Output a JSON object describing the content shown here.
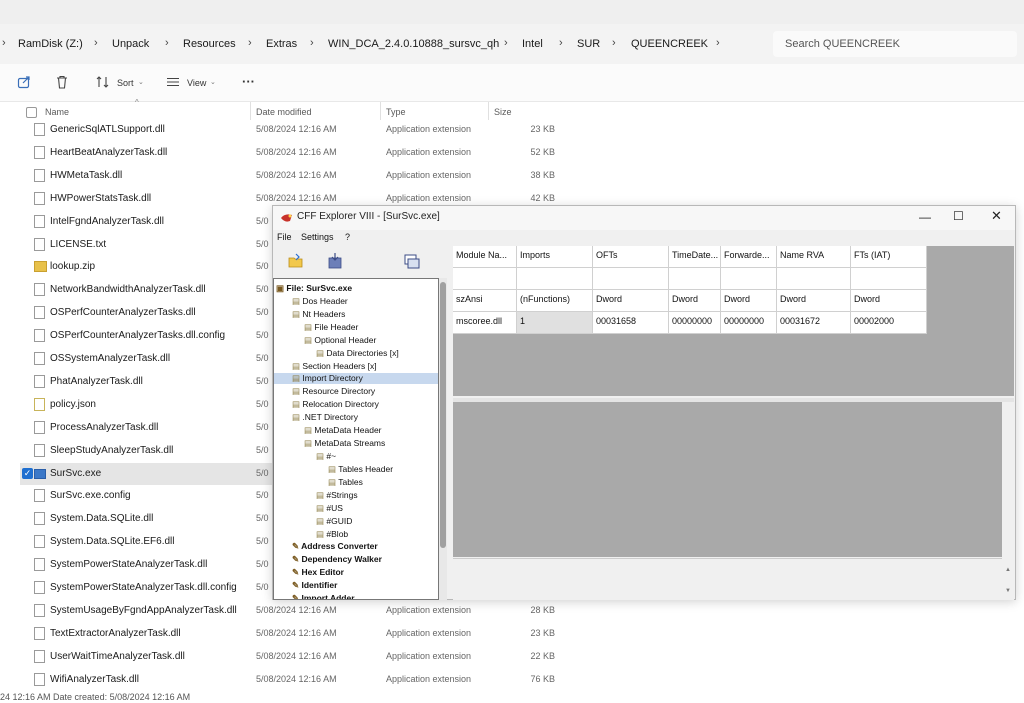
{
  "address": {
    "crumbs": [
      "RamDisk (Z:)",
      "Unpack",
      "Resources",
      "Extras",
      "WIN_DCA_2.4.0.10888_sursvc_qh",
      "Intel",
      "SUR",
      "QUEENCREEK"
    ],
    "search_placeholder": "Search QUEENCREEK"
  },
  "toolbar": {
    "sort_label": "Sort",
    "view_label": "View",
    "more_label": "···"
  },
  "columns": {
    "name": "Name",
    "date": "Date modified",
    "type": "Type",
    "size": "Size"
  },
  "files": [
    {
      "name": "GenericSqlATLSupport.dll",
      "date": "5/08/2024 12:16 AM",
      "type": "Application extension",
      "size": "23 KB"
    },
    {
      "name": "HeartBeatAnalyzerTask.dll",
      "date": "5/08/2024 12:16 AM",
      "type": "Application extension",
      "size": "52 KB"
    },
    {
      "name": "HWMetaTask.dll",
      "date": "5/08/2024 12:16 AM",
      "type": "Application extension",
      "size": "38 KB"
    },
    {
      "name": "HWPowerStatsTask.dll",
      "date": "5/08/2024 12:16 AM",
      "type": "Application extension",
      "size": "42 KB"
    },
    {
      "name": "IntelFgndAnalyzerTask.dll",
      "date": "5/0",
      "type": "",
      "size": ""
    },
    {
      "name": "LICENSE.txt",
      "date": "5/0",
      "type": "",
      "size": ""
    },
    {
      "name": "lookup.zip",
      "date": "5/0",
      "type": "",
      "size": ""
    },
    {
      "name": "NetworkBandwidthAnalyzerTask.dll",
      "date": "5/0",
      "type": "",
      "size": ""
    },
    {
      "name": "OSPerfCounterAnalyzerTasks.dll",
      "date": "5/0",
      "type": "",
      "size": ""
    },
    {
      "name": "OSPerfCounterAnalyzerTasks.dll.config",
      "date": "5/0",
      "type": "",
      "size": ""
    },
    {
      "name": "OSSystemAnalyzerTask.dll",
      "date": "5/0",
      "type": "",
      "size": ""
    },
    {
      "name": "PhatAnalyzerTask.dll",
      "date": "5/0",
      "type": "",
      "size": ""
    },
    {
      "name": "policy.json",
      "date": "5/0",
      "type": "",
      "size": ""
    },
    {
      "name": "ProcessAnalyzerTask.dll",
      "date": "5/0",
      "type": "",
      "size": ""
    },
    {
      "name": "SleepStudyAnalyzerTask.dll",
      "date": "5/0",
      "type": "",
      "size": ""
    },
    {
      "name": "SurSvc.exe",
      "date": "5/0",
      "type": "",
      "size": ""
    },
    {
      "name": "SurSvc.exe.config",
      "date": "5/0",
      "type": "",
      "size": ""
    },
    {
      "name": "System.Data.SQLite.dll",
      "date": "5/0",
      "type": "",
      "size": ""
    },
    {
      "name": "System.Data.SQLite.EF6.dll",
      "date": "5/0",
      "type": "",
      "size": ""
    },
    {
      "name": "SystemPowerStateAnalyzerTask.dll",
      "date": "5/0",
      "type": "",
      "size": ""
    },
    {
      "name": "SystemPowerStateAnalyzerTask.dll.config",
      "date": "5/0",
      "type": "",
      "size": ""
    },
    {
      "name": "SystemUsageByFgndAppAnalyzerTask.dll",
      "date": "5/08/2024 12:16 AM",
      "type": "Application extension",
      "size": "28 KB"
    },
    {
      "name": "TextExtractorAnalyzerTask.dll",
      "date": "5/08/2024 12:16 AM",
      "type": "Application extension",
      "size": "23 KB"
    },
    {
      "name": "UserWaitTimeAnalyzerTask.dll",
      "date": "5/08/2024 12:16 AM",
      "type": "Application extension",
      "size": "22 KB"
    },
    {
      "name": "WifiAnalyzerTask.dll",
      "date": "5/08/2024 12:16 AM",
      "type": "Application extension",
      "size": "76 KB"
    }
  ],
  "status": "24 12:16 AM    Date created: 5/08/2024 12:16 AM",
  "cff": {
    "title": "CFF Explorer VIII - [SurSvc.exe]",
    "menu": [
      "File",
      "Settings",
      "?"
    ],
    "tree": [
      {
        "label": "File: SurSvc.exe",
        "bold": true
      },
      {
        "label": "Dos Header"
      },
      {
        "label": "Nt Headers"
      },
      {
        "label": "File Header"
      },
      {
        "label": "Optional Header"
      },
      {
        "label": "Data Directories [x]"
      },
      {
        "label": "Section Headers [x]"
      },
      {
        "label": "Import Directory",
        "selected": true
      },
      {
        "label": "Resource Directory"
      },
      {
        "label": "Relocation Directory"
      },
      {
        "label": ".NET Directory"
      },
      {
        "label": "MetaData Header"
      },
      {
        "label": "MetaData Streams"
      },
      {
        "label": "#~"
      },
      {
        "label": "Tables Header"
      },
      {
        "label": "Tables"
      },
      {
        "label": "#Strings"
      },
      {
        "label": "#US"
      },
      {
        "label": "#GUID"
      },
      {
        "label": "#Blob"
      },
      {
        "label": "Address Converter",
        "bold": true
      },
      {
        "label": "Dependency Walker",
        "bold": true
      },
      {
        "label": "Hex Editor",
        "bold": true
      },
      {
        "label": "Identifier",
        "bold": true
      },
      {
        "label": "Import Adder",
        "bold": true
      }
    ],
    "grid": {
      "headers": [
        "Module Na...",
        "Imports",
        "OFTs",
        "TimeDate...",
        "Forwarde...",
        "Name RVA",
        "FTs (IAT)"
      ],
      "types": [
        "szAnsi",
        "(nFunctions)",
        "Dword",
        "Dword",
        "Dword",
        "Dword",
        "Dword"
      ],
      "row": [
        "mscoree.dll",
        "1",
        "00031658",
        "00000000",
        "00000000",
        "00031672",
        "00002000"
      ]
    }
  }
}
